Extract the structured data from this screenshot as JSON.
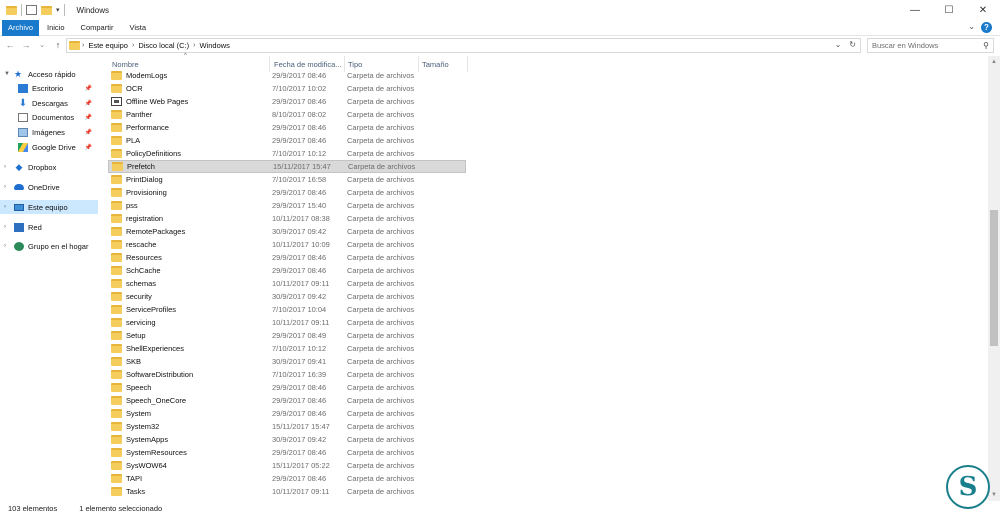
{
  "window": {
    "title": "Windows",
    "controls": [
      "—",
      "☐",
      "✕"
    ]
  },
  "ribbon": {
    "tabs": [
      "Archivo",
      "Inicio",
      "Compartir",
      "Vista"
    ],
    "expand_icon": "⌄",
    "help_icon": "?"
  },
  "address": {
    "back": "←",
    "forward": "→",
    "recent": "⌄",
    "up": "↑",
    "crumbs": [
      "Este equipo",
      "Disco local (C:)",
      "Windows"
    ],
    "dropdown": "⌄",
    "refresh": "↻",
    "search_placeholder": "Buscar en Windows",
    "search_icon": "⚲"
  },
  "nav": {
    "items": [
      {
        "label": "Acceso rápido",
        "icon": "star-icon",
        "level": 0,
        "expanded": true
      },
      {
        "label": "Escritorio",
        "icon": "desktop-icon",
        "level": 1,
        "pinned": true
      },
      {
        "label": "Descargas",
        "icon": "download-icon",
        "level": 1,
        "pinned": true
      },
      {
        "label": "Documentos",
        "icon": "documents-icon",
        "level": 1,
        "pinned": true
      },
      {
        "label": "Imágenes",
        "icon": "pictures-icon",
        "level": 1,
        "pinned": true
      },
      {
        "label": "Google Drive",
        "icon": "google-drive-icon",
        "level": 1,
        "pinned": true
      },
      {
        "label": "Dropbox",
        "icon": "dropbox-icon",
        "level": 0
      },
      {
        "label": "OneDrive",
        "icon": "onedrive-icon",
        "level": 0
      },
      {
        "label": "Este equipo",
        "icon": "this-pc-icon",
        "level": 0,
        "selected": true
      },
      {
        "label": "Red",
        "icon": "network-icon",
        "level": 0
      },
      {
        "label": "Grupo en el hogar",
        "icon": "homegroup-icon",
        "level": 0
      }
    ]
  },
  "columns": [
    "Nombre",
    "Fecha de modifica...",
    "Tipo",
    "Tamaño"
  ],
  "files": [
    {
      "name": "ModemLogs",
      "date": "29/9/2017 08:46",
      "type": "Carpeta de archivos"
    },
    {
      "name": "OCR",
      "date": "7/10/2017 10:02",
      "type": "Carpeta de archivos"
    },
    {
      "name": "Offline Web Pages",
      "date": "29/9/2017 08:46",
      "type": "Carpeta de archivos",
      "special": true
    },
    {
      "name": "Panther",
      "date": "8/10/2017 08:02",
      "type": "Carpeta de archivos"
    },
    {
      "name": "Performance",
      "date": "29/9/2017 08:46",
      "type": "Carpeta de archivos"
    },
    {
      "name": "PLA",
      "date": "29/9/2017 08:46",
      "type": "Carpeta de archivos"
    },
    {
      "name": "PolicyDefinitions",
      "date": "7/10/2017 10:12",
      "type": "Carpeta de archivos"
    },
    {
      "name": "Prefetch",
      "date": "15/11/2017 15:47",
      "type": "Carpeta de archivos",
      "selected": true
    },
    {
      "name": "PrintDialog",
      "date": "7/10/2017 16:58",
      "type": "Carpeta de archivos"
    },
    {
      "name": "Provisioning",
      "date": "29/9/2017 08:46",
      "type": "Carpeta de archivos"
    },
    {
      "name": "pss",
      "date": "29/9/2017 15:40",
      "type": "Carpeta de archivos"
    },
    {
      "name": "registration",
      "date": "10/11/2017 08:38",
      "type": "Carpeta de archivos"
    },
    {
      "name": "RemotePackages",
      "date": "30/9/2017 09:42",
      "type": "Carpeta de archivos"
    },
    {
      "name": "rescache",
      "date": "10/11/2017 10:09",
      "type": "Carpeta de archivos"
    },
    {
      "name": "Resources",
      "date": "29/9/2017 08:46",
      "type": "Carpeta de archivos"
    },
    {
      "name": "SchCache",
      "date": "29/9/2017 08:46",
      "type": "Carpeta de archivos"
    },
    {
      "name": "schemas",
      "date": "10/11/2017 09:11",
      "type": "Carpeta de archivos"
    },
    {
      "name": "security",
      "date": "30/9/2017 09:42",
      "type": "Carpeta de archivos"
    },
    {
      "name": "ServiceProfiles",
      "date": "7/10/2017 10:04",
      "type": "Carpeta de archivos"
    },
    {
      "name": "servicing",
      "date": "10/11/2017 09:11",
      "type": "Carpeta de archivos"
    },
    {
      "name": "Setup",
      "date": "29/9/2017 08:49",
      "type": "Carpeta de archivos"
    },
    {
      "name": "ShellExperiences",
      "date": "7/10/2017 10:12",
      "type": "Carpeta de archivos"
    },
    {
      "name": "SKB",
      "date": "30/9/2017 09:41",
      "type": "Carpeta de archivos"
    },
    {
      "name": "SoftwareDistribution",
      "date": "7/10/2017 16:39",
      "type": "Carpeta de archivos"
    },
    {
      "name": "Speech",
      "date": "29/9/2017 08:46",
      "type": "Carpeta de archivos"
    },
    {
      "name": "Speech_OneCore",
      "date": "29/9/2017 08:46",
      "type": "Carpeta de archivos"
    },
    {
      "name": "System",
      "date": "29/9/2017 08:46",
      "type": "Carpeta de archivos"
    },
    {
      "name": "System32",
      "date": "15/11/2017 15:47",
      "type": "Carpeta de archivos"
    },
    {
      "name": "SystemApps",
      "date": "30/9/2017 09:42",
      "type": "Carpeta de archivos"
    },
    {
      "name": "SystemResources",
      "date": "29/9/2017 08:46",
      "type": "Carpeta de archivos"
    },
    {
      "name": "SysWOW64",
      "date": "15/11/2017 05:22",
      "type": "Carpeta de archivos"
    },
    {
      "name": "TAPI",
      "date": "29/9/2017 08:46",
      "type": "Carpeta de archivos"
    },
    {
      "name": "Tasks",
      "date": "10/11/2017 09:11",
      "type": "Carpeta de archivos"
    }
  ],
  "status": {
    "count": "103 elementos",
    "selection": "1 elemento seleccionado"
  },
  "colors": {
    "file_tab": "#1979ca",
    "nav_selected": "#cce8ff",
    "row_selected": "#d9d9d9",
    "folder": "#f5cd5c"
  }
}
